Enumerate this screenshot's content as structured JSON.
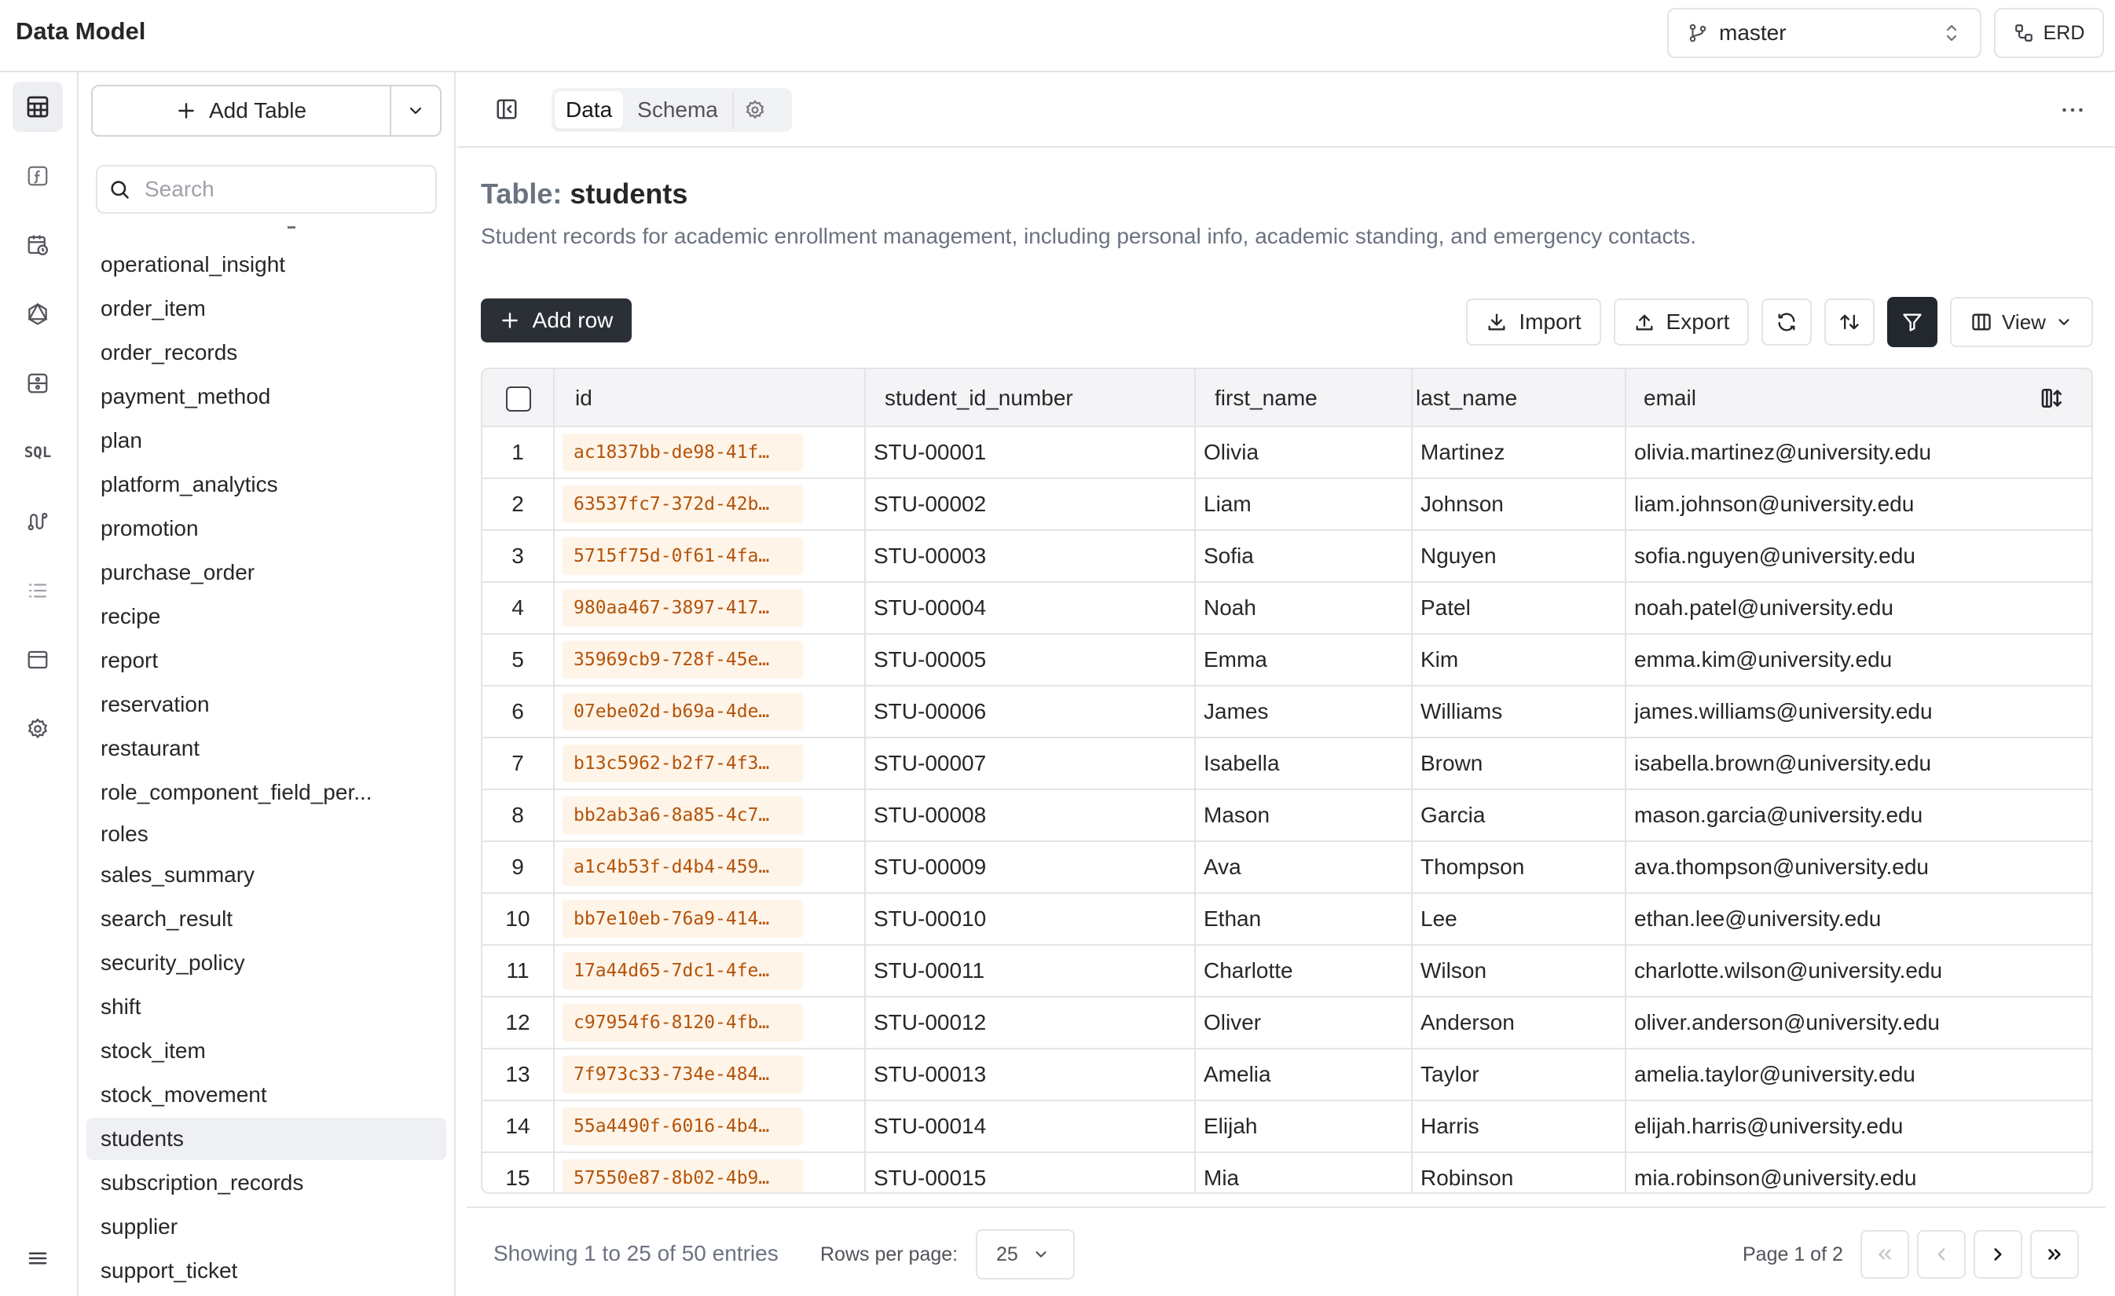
{
  "app": {
    "title": "Data Model"
  },
  "branch": {
    "name": "master"
  },
  "erd": {
    "label": "ERD"
  },
  "sidebar": {
    "add_table_label": "Add Table",
    "search_placeholder": "Search",
    "items": [
      "operational_insight",
      "order_item",
      "order_records",
      "payment_method",
      "plan",
      "platform_analytics",
      "promotion",
      "purchase_order",
      "recipe",
      "report",
      "reservation",
      "restaurant",
      "role_component_field_per...",
      "roles",
      "sales_summary",
      "search_result",
      "security_policy",
      "shift",
      "stock_item",
      "stock_movement",
      "students",
      "subscription_records",
      "supplier",
      "support_ticket"
    ],
    "selected": "students"
  },
  "tabs": {
    "data": "Data",
    "schema": "Schema",
    "active": "Data"
  },
  "table": {
    "title_prefix": "Table:",
    "name": "students",
    "description": "Student records for academic enrollment management, including personal info, academic standing, and emergency contacts."
  },
  "actions": {
    "add_row": "Add row",
    "import": "Import",
    "export": "Export",
    "view": "View"
  },
  "grid": {
    "columns": [
      "id",
      "student_id_number",
      "first_name",
      "last_name",
      "email"
    ],
    "rows": [
      [
        "1",
        "ac1837bb-de98-41f…",
        "STU-00001",
        "Olivia",
        "Martinez",
        "olivia.martinez@university.edu"
      ],
      [
        "2",
        "63537fc7-372d-42b…",
        "STU-00002",
        "Liam",
        "Johnson",
        "liam.johnson@university.edu"
      ],
      [
        "3",
        "5715f75d-0f61-4fa…",
        "STU-00003",
        "Sofia",
        "Nguyen",
        "sofia.nguyen@university.edu"
      ],
      [
        "4",
        "980aa467-3897-417…",
        "STU-00004",
        "Noah",
        "Patel",
        "noah.patel@university.edu"
      ],
      [
        "5",
        "35969cb9-728f-45e…",
        "STU-00005",
        "Emma",
        "Kim",
        "emma.kim@university.edu"
      ],
      [
        "6",
        "07ebe02d-b69a-4de…",
        "STU-00006",
        "James",
        "Williams",
        "james.williams@university.edu"
      ],
      [
        "7",
        "b13c5962-b2f7-4f3…",
        "STU-00007",
        "Isabella",
        "Brown",
        "isabella.brown@university.edu"
      ],
      [
        "8",
        "bb2ab3a6-8a85-4c7…",
        "STU-00008",
        "Mason",
        "Garcia",
        "mason.garcia@university.edu"
      ],
      [
        "9",
        "a1c4b53f-d4b4-459…",
        "STU-00009",
        "Ava",
        "Thompson",
        "ava.thompson@university.edu"
      ],
      [
        "10",
        "bb7e10eb-76a9-414…",
        "STU-00010",
        "Ethan",
        "Lee",
        "ethan.lee@university.edu"
      ],
      [
        "11",
        "17a44d65-7dc1-4fe…",
        "STU-00011",
        "Charlotte",
        "Wilson",
        "charlotte.wilson@university.edu"
      ],
      [
        "12",
        "c97954f6-8120-4fb…",
        "STU-00012",
        "Oliver",
        "Anderson",
        "oliver.anderson@university.edu"
      ],
      [
        "13",
        "7f973c33-734e-484…",
        "STU-00013",
        "Amelia",
        "Taylor",
        "amelia.taylor@university.edu"
      ],
      [
        "14",
        "55a4490f-6016-4b4…",
        "STU-00014",
        "Elijah",
        "Harris",
        "elijah.harris@university.edu"
      ],
      [
        "15",
        "57550e87-8b02-4b9…",
        "STU-00015",
        "Mia",
        "Robinson",
        "mia.robinson@university.edu"
      ]
    ]
  },
  "footer": {
    "showing": "Showing 1 to 25 of 50 entries",
    "rows_per_page_label": "Rows per page:",
    "rows_per_page": "25",
    "page_info": "Page 1 of 2"
  },
  "colors": {
    "accent_dark": "#23272e",
    "uuid_text": "#b45309",
    "uuid_bg": "#fff4e8",
    "selected_bg": "#eef0f4"
  },
  "icons": {
    "rail": [
      "table-icon",
      "function-icon",
      "schedule-icon",
      "graphql-icon",
      "storage-icon",
      "sql-icon",
      "workflow-icon",
      "list-icon",
      "window-icon",
      "settings-icon"
    ]
  }
}
